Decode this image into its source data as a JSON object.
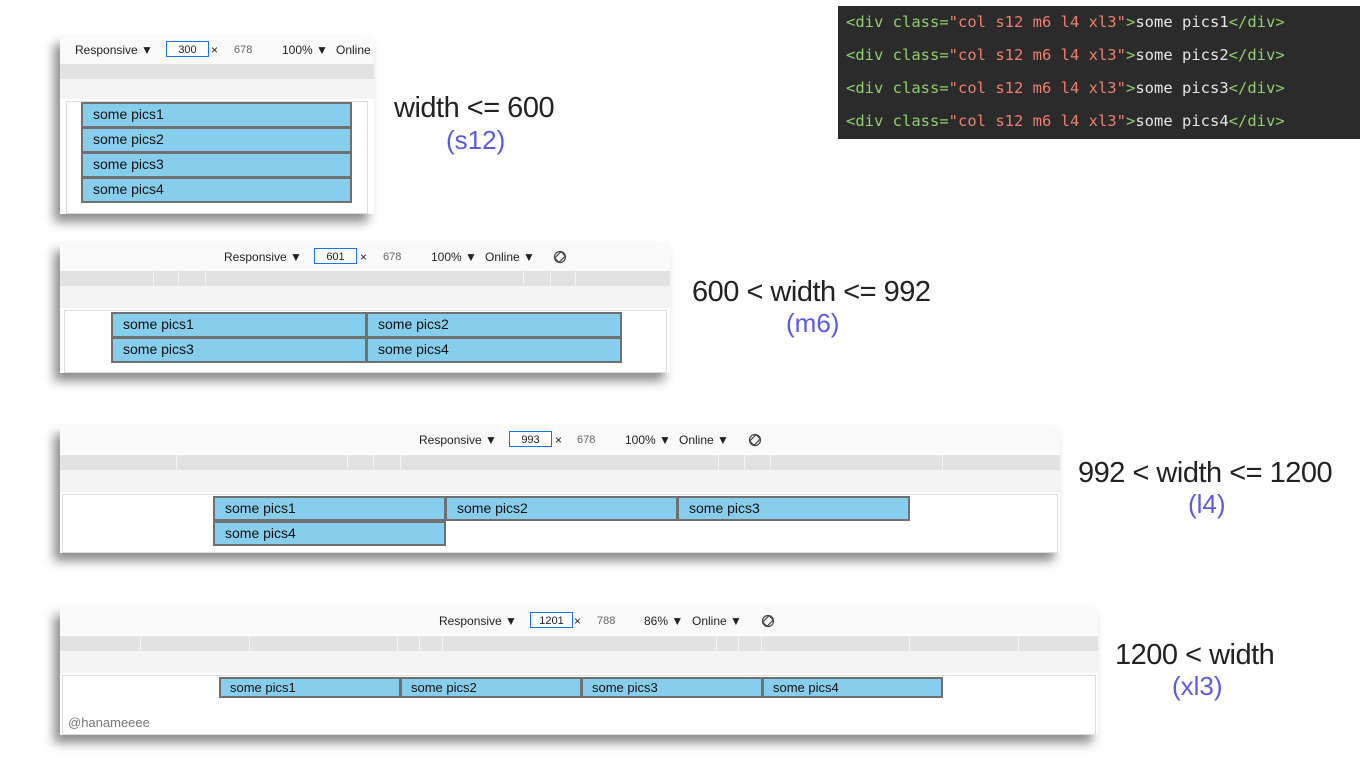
{
  "code": {
    "lines": [
      {
        "open": "<div ",
        "attr": "class=",
        "value": "\"col s12 m6 l4 xl3\"",
        "close_open": ">",
        "text": "some pics1",
        "close": "</div>"
      },
      {
        "open": "<div ",
        "attr": "class=",
        "value": "\"col s12 m6 l4 xl3\"",
        "close_open": ">",
        "text": "some pics2",
        "close": "</div>"
      },
      {
        "open": "<div ",
        "attr": "class=",
        "value": "\"col s12 m6 l4 xl3\"",
        "close_open": ">",
        "text": "some pics3",
        "close": "</div>"
      },
      {
        "open": "<div ",
        "attr": "class=",
        "value": "\"col s12 m6 l4 xl3\"",
        "close_open": ">",
        "text": "some pics4",
        "close": "</div>"
      }
    ]
  },
  "panels": [
    {
      "toolbar": {
        "device": "Responsive ▼",
        "width": "300",
        "times": "×",
        "height": "678",
        "zoom": "100% ▼",
        "network": "Online"
      },
      "cells": [
        "some pics1",
        "some pics2",
        "some pics3",
        "some pics4"
      ],
      "label": "width <= 600",
      "sublabel": "(s12)"
    },
    {
      "toolbar": {
        "device": "Responsive ▼",
        "width": "601",
        "times": "×",
        "height": "678",
        "zoom": "100% ▼",
        "network": "Online ▼"
      },
      "cells": [
        "some pics1",
        "some pics2",
        "some pics3",
        "some pics4"
      ],
      "label": "600 < width  <= 992",
      "sublabel": "(m6)"
    },
    {
      "toolbar": {
        "device": "Responsive ▼",
        "width": "993",
        "times": "×",
        "height": "678",
        "zoom": "100% ▼",
        "network": "Online ▼"
      },
      "cells": [
        "some pics1",
        "some pics2",
        "some pics3",
        "some pics4"
      ],
      "label": "992 < width  <= 1200",
      "sublabel": "(l4)"
    },
    {
      "toolbar": {
        "device": "Responsive ▼",
        "width": "1201",
        "times": "×",
        "height": "788",
        "zoom": "86% ▼",
        "network": "Online ▼"
      },
      "cells": [
        "some pics1",
        "some pics2",
        "some pics3",
        "some pics4"
      ],
      "label": "1200 < width",
      "sublabel": "(xl3)"
    }
  ],
  "watermark": "@hanameeee",
  "icons": {
    "rotate": "rotate-icon"
  },
  "colors": {
    "cell": "#87cdec",
    "cell_border": "#707070",
    "sublabel": "#5a5ae6",
    "input_border": "#1a73e8",
    "code_bg": "#2b2b2b"
  }
}
